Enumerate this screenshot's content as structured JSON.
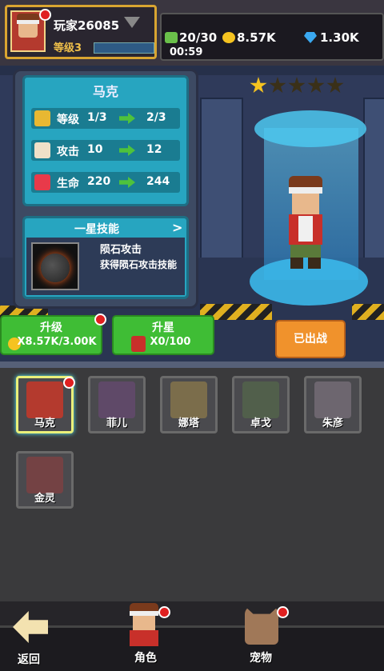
{
  "player": {
    "name": "玩家26085",
    "level": "等级3"
  },
  "resources": {
    "energy": "20/30",
    "gold": "8.57K",
    "gems": "1.30K",
    "timer": "00:59"
  },
  "stars": {
    "filled": 1,
    "total": 5
  },
  "hero": {
    "name": "马克",
    "stats": [
      {
        "label": "等级",
        "current": "1/3",
        "next": "2/3",
        "icon": "level-badge-icon",
        "color": "#e8b832"
      },
      {
        "label": "攻击",
        "current": "10",
        "next": "12",
        "icon": "fist-icon",
        "color": "#f0e0c8"
      },
      {
        "label": "生命",
        "current": "220",
        "next": "244",
        "icon": "heart-icon",
        "color": "#e83a4a"
      }
    ],
    "skill": {
      "title": "一星技能",
      "arrow": ">",
      "name": "陨石攻击",
      "desc": "获得陨石攻击技能"
    }
  },
  "buttons": {
    "upgrade": {
      "label": "升级",
      "value": "X8.57K/3.00K"
    },
    "star_up": {
      "label": "升星",
      "value": "X0/100"
    },
    "deploy": {
      "label": "已出战"
    }
  },
  "roster": [
    {
      "name": "马克",
      "selected": true,
      "color": "#b43a2e"
    },
    {
      "name": "菲儿",
      "selected": false,
      "color": "#7a4a8a"
    },
    {
      "name": "娜塔",
      "selected": false,
      "color": "#b89a4a"
    },
    {
      "name": "卓戈",
      "selected": false,
      "color": "#5a7a4a"
    },
    {
      "name": "朱彦",
      "selected": false,
      "color": "#9a8a9a"
    },
    {
      "name": "金灵",
      "selected": false,
      "color": "#a83a3a"
    }
  ],
  "nav": {
    "back": "返回",
    "character": "角色",
    "pet": "宠物"
  }
}
